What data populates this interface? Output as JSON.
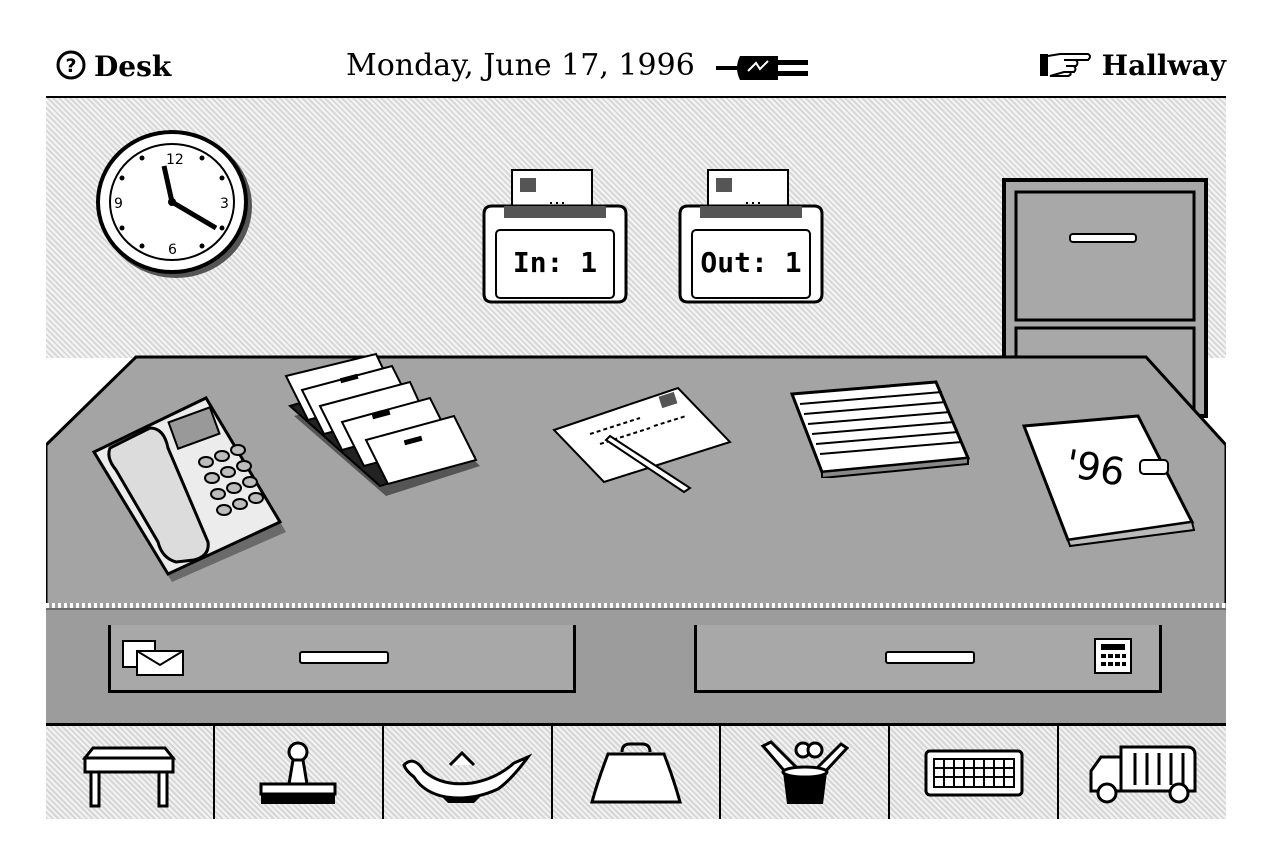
{
  "titlebar": {
    "help_label": "Desk",
    "date": "Monday, June 17, 1996",
    "destination_label": "Hallway",
    "icons": [
      "help-icon",
      "power-plug-icon",
      "pointing-hand-icon"
    ]
  },
  "trays": {
    "in_label": "In: 1",
    "out_label": "Out: 1"
  },
  "calendar_book": {
    "year_label": "'96"
  },
  "toolbar": {
    "items": [
      {
        "icon": "desk-icon"
      },
      {
        "icon": "rubber-stamp-icon"
      },
      {
        "icon": "magic-lamp-icon"
      },
      {
        "icon": "briefcase-icon"
      },
      {
        "icon": "pencil-cup-icon"
      },
      {
        "icon": "keyboard-icon"
      },
      {
        "icon": "trash-truck-icon"
      }
    ]
  }
}
